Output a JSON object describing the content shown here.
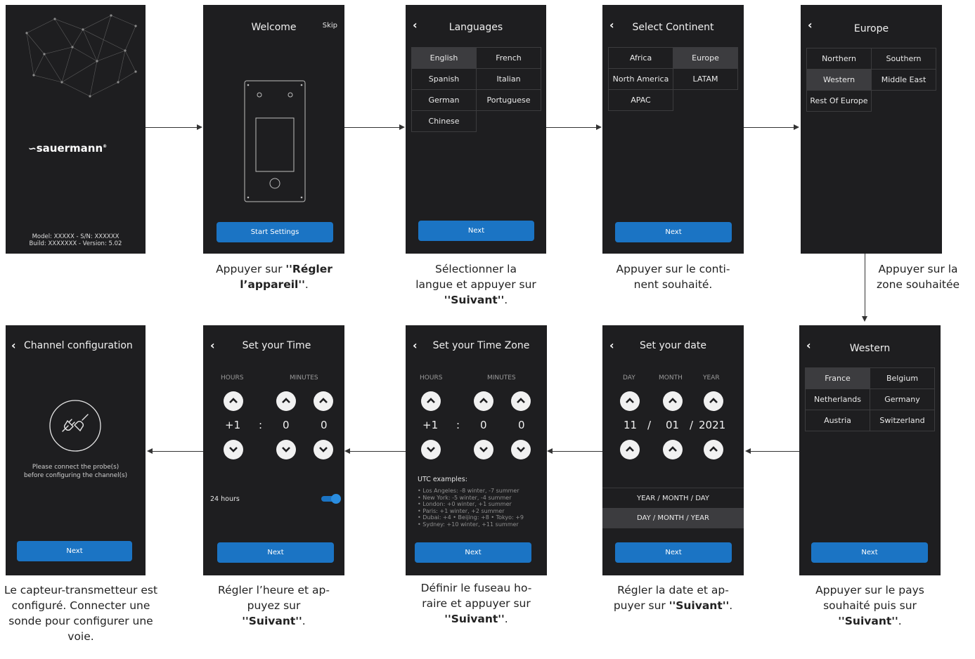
{
  "screens": {
    "logo": {
      "brand": "sauermann",
      "model_line": "Model: XXXXX - S/N: XXXXXX",
      "build_line": "Build: XXXXXXX - Version: 5.02"
    },
    "welcome": {
      "title": "Welcome",
      "skip": "Skip",
      "button": "Start Settings"
    },
    "languages": {
      "title": "Languages",
      "options": [
        "English",
        "French",
        "Spanish",
        "Italian",
        "German",
        "Portuguese",
        "Chinese"
      ],
      "selected": "English",
      "button": "Next"
    },
    "continent": {
      "title": "Select Continent",
      "options": [
        "Africa",
        "Europe",
        "North America",
        "LATAM",
        "APAC"
      ],
      "selected": "Europe",
      "button": "Next"
    },
    "europe": {
      "title": "Europe",
      "options": [
        "Northern",
        "Southern",
        "Western",
        "Middle East",
        "Rest Of Europe"
      ],
      "selected": "Western"
    },
    "western": {
      "title": "Western",
      "options": [
        "France",
        "Belgium",
        "Netherlands",
        "Germany",
        "Austria",
        "Switzerland"
      ],
      "selected": "France",
      "button": "Next"
    },
    "date": {
      "title": "Set your date",
      "labels": [
        "DAY",
        "MONTH",
        "YEAR"
      ],
      "day": "11",
      "sep1": "/",
      "month": "01",
      "sep2": "/",
      "year": "2021",
      "format1": "YEAR / MONTH / DAY",
      "format2": "DAY / MONTH / YEAR",
      "selected_format": "DAY / MONTH / YEAR",
      "button": "Next"
    },
    "timezone": {
      "title": "Set your Time Zone",
      "label_hours": "HOURS",
      "label_minutes": "MINUTES",
      "hours": "+1",
      "colon": ":",
      "min1": "0",
      "min2": "0",
      "utc_title": "UTC examples:",
      "utc_lines": [
        "• Los Angeles: -8 winter, -7 summer",
        "• New York: -5 winter, -4 summer",
        "• London: +0 winter, +1 summer",
        "• Paris: +1 winter, +2 summer",
        "• Dubai: +4  • Beijing: +8  • Tokyo: +9",
        "• Sydney: +10 winter, +11 summer"
      ],
      "button": "Next"
    },
    "time": {
      "title": "Set your Time",
      "label_hours": "HOURS",
      "label_minutes": "MINUTES",
      "hours": "+1",
      "colon": ":",
      "min1": "0",
      "min2": "0",
      "toggle_label": "24 hours",
      "toggle_on": true,
      "button": "Next"
    },
    "channel": {
      "title": "Channel configuration",
      "message_line1": "Please connect the probe(s)",
      "message_line2": "before configuring the channel(s)",
      "button": "Next"
    }
  },
  "captions": {
    "welcome": {
      "pre": "Appuyer sur ",
      "bold1": "''Régler",
      "bold2": "l’appareil''",
      "post": "."
    },
    "languages": {
      "line1": "Sélectionner la",
      "line2": "langue et appuyer sur",
      "bold": "''Suivant''",
      "post": "."
    },
    "continent": {
      "line1": "Appuyer sur le conti-",
      "line2": "nent souhaité."
    },
    "europe": {
      "line1": "Appuyer sur la",
      "line2": "zone souhaitée"
    },
    "western": {
      "line1": "Appuyer sur le pays",
      "line2": "souhaité puis sur",
      "bold": "''Suivant''",
      "post": "."
    },
    "date": {
      "line1": "Régler la date et ap-",
      "line2_pre": "puyer sur ",
      "bold": "''Suivant''",
      "post": "."
    },
    "timezone": {
      "line1": "Définir le fuseau ho-",
      "line2": "raire et appuyer sur",
      "bold": "''Suivant''",
      "post": "."
    },
    "time": {
      "line1": "Régler l’heure et ap-",
      "line2": "puyez sur",
      "bold": "''Suivant''",
      "post": "."
    },
    "channel": {
      "line1": "Le capteur-transmetteur est",
      "line2": "configuré. Connecter une",
      "line3": "sonde pour configurer une",
      "line4": "voie."
    }
  }
}
